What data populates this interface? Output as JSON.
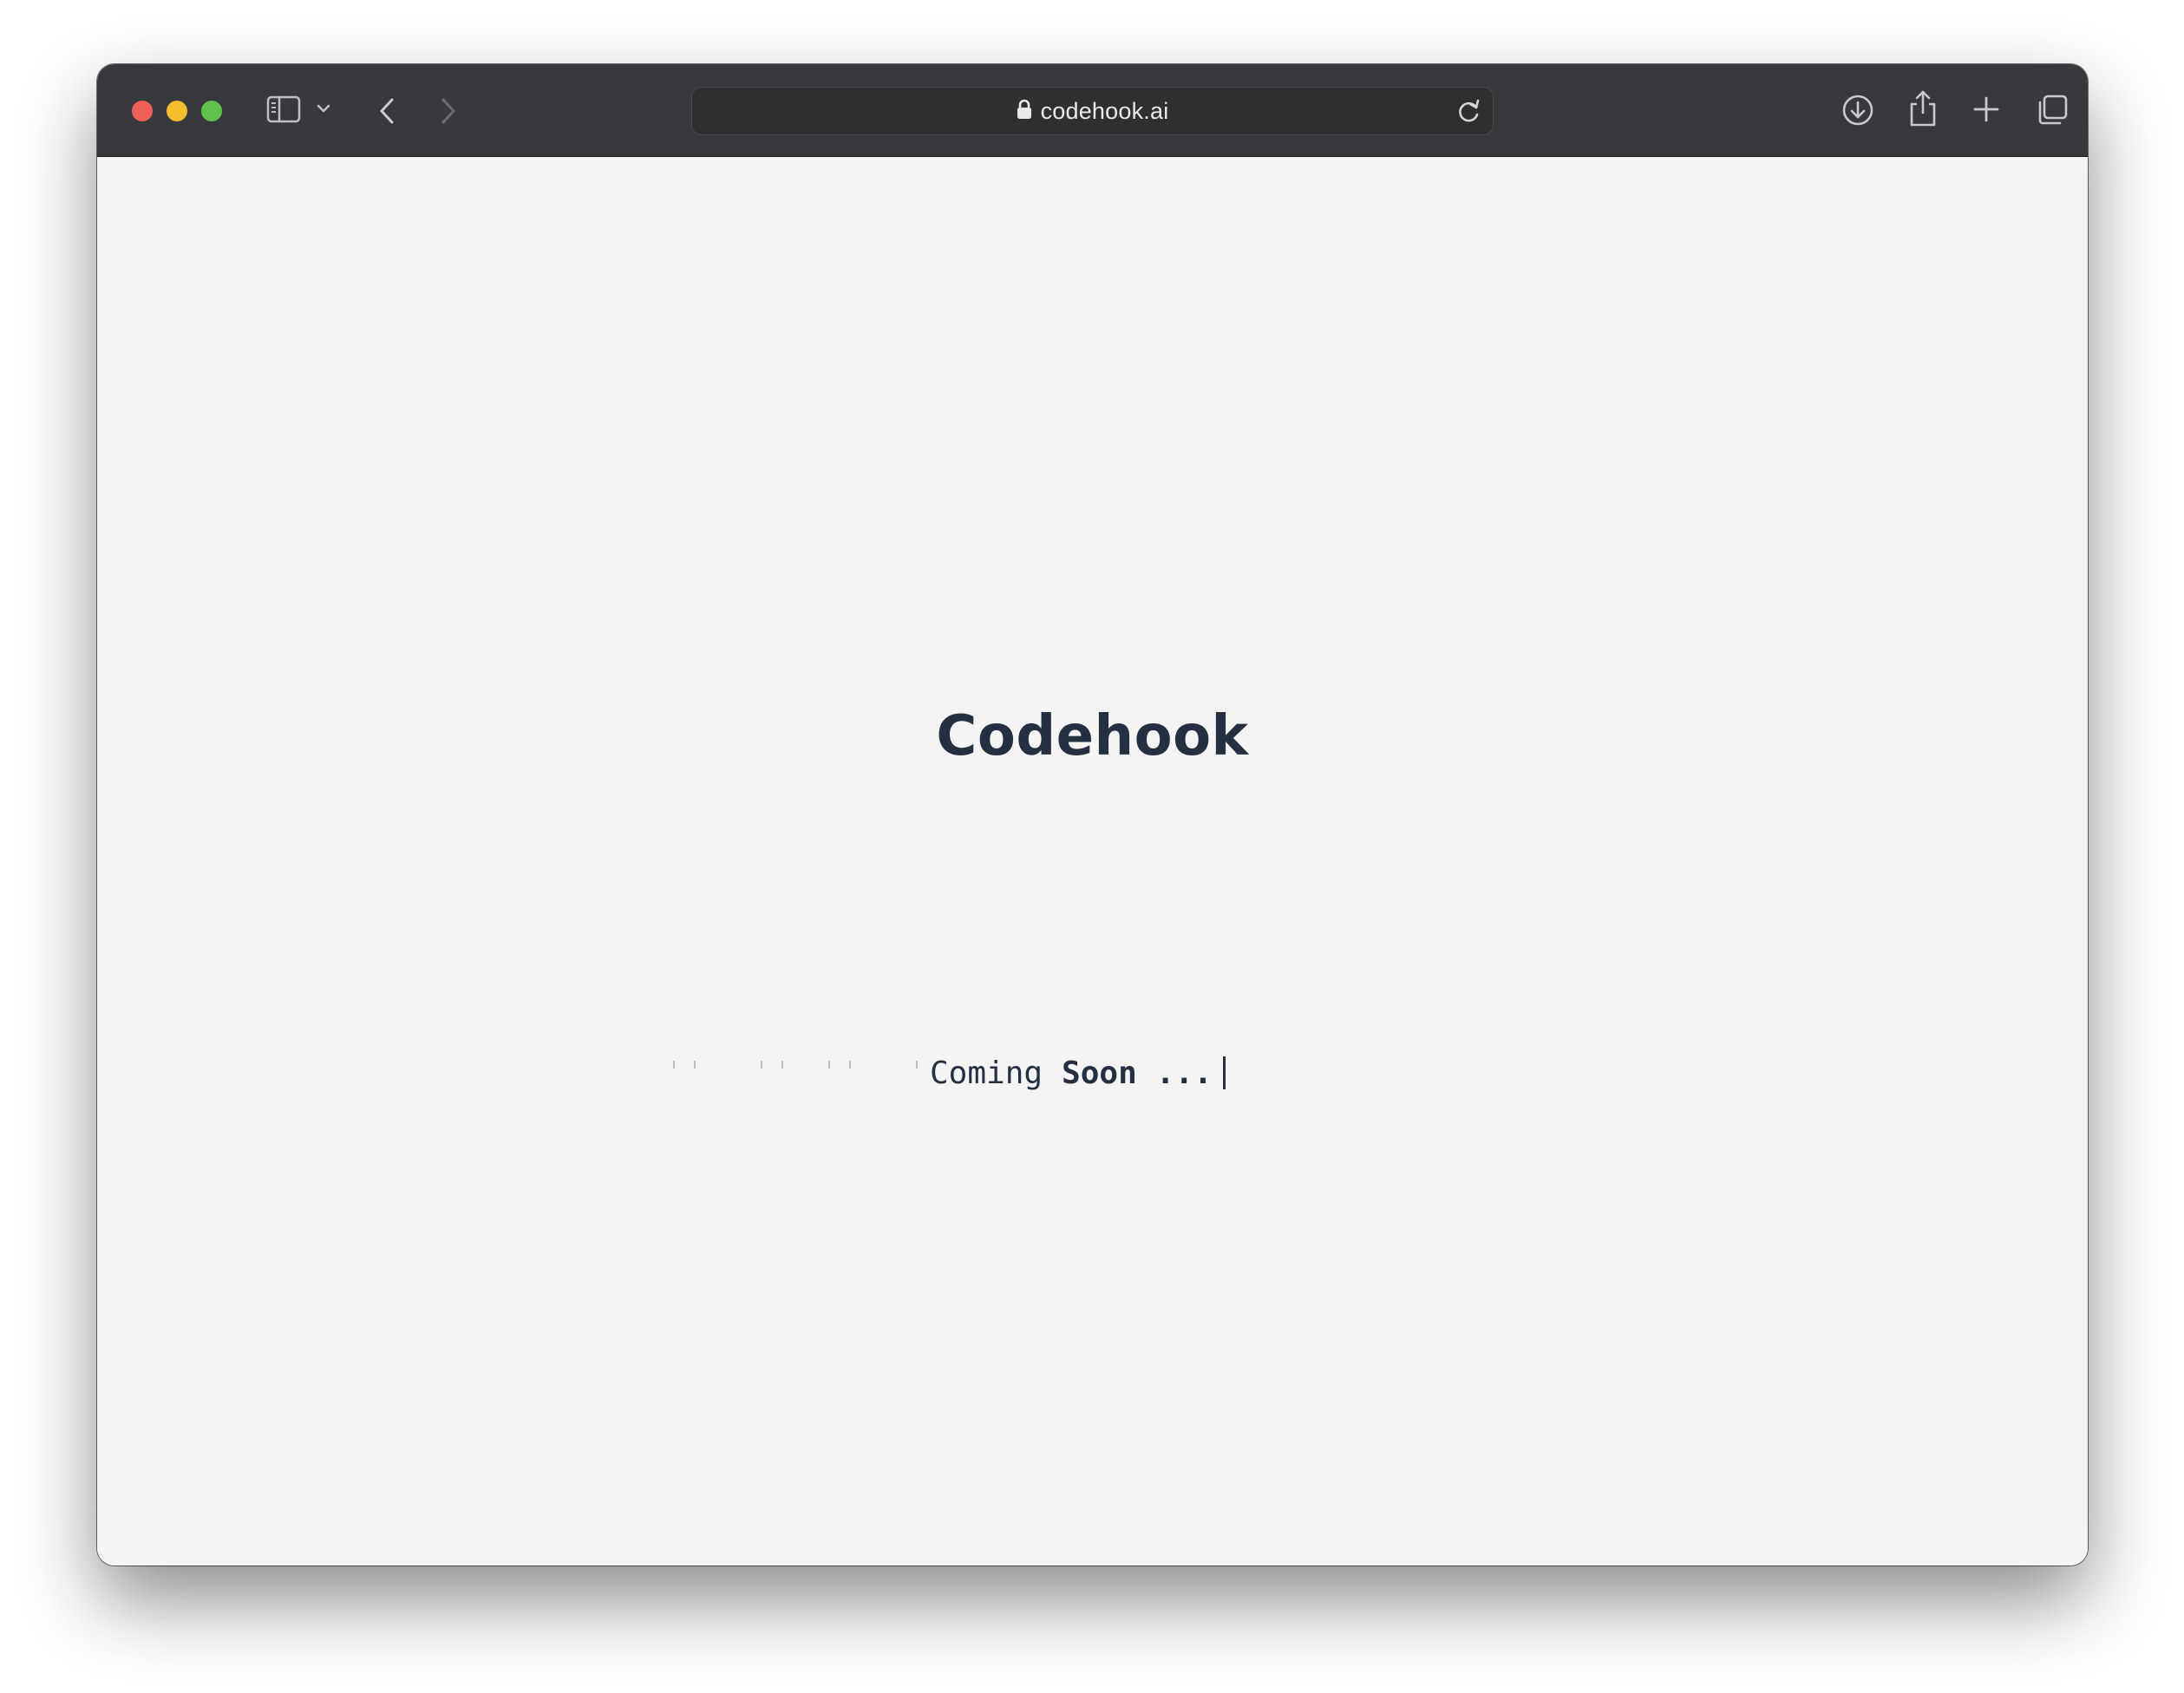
{
  "browser": {
    "url": "codehook.ai",
    "icons": {
      "sidebar": "sidebar-icon",
      "sidebar_menu": "chevron-down-icon",
      "back": "chevron-left-icon",
      "forward": "chevron-right-icon",
      "lock": "lock-icon",
      "reload": "reload-icon",
      "downloads": "download-icon",
      "share": "share-icon",
      "new_tab": "plus-icon",
      "tabs": "tab-overview-icon"
    },
    "colors": {
      "close": "#ee5f57",
      "minimize": "#f4bd2f",
      "maximize": "#5fc24a",
      "toolbar": "#38393c"
    }
  },
  "page": {
    "title": "Codehook",
    "tagline_word1": "Coming",
    "tagline_word2": "Soon",
    "tagline_suffix": "...",
    "text_color": "#243042",
    "background": "#f4f4f4"
  }
}
